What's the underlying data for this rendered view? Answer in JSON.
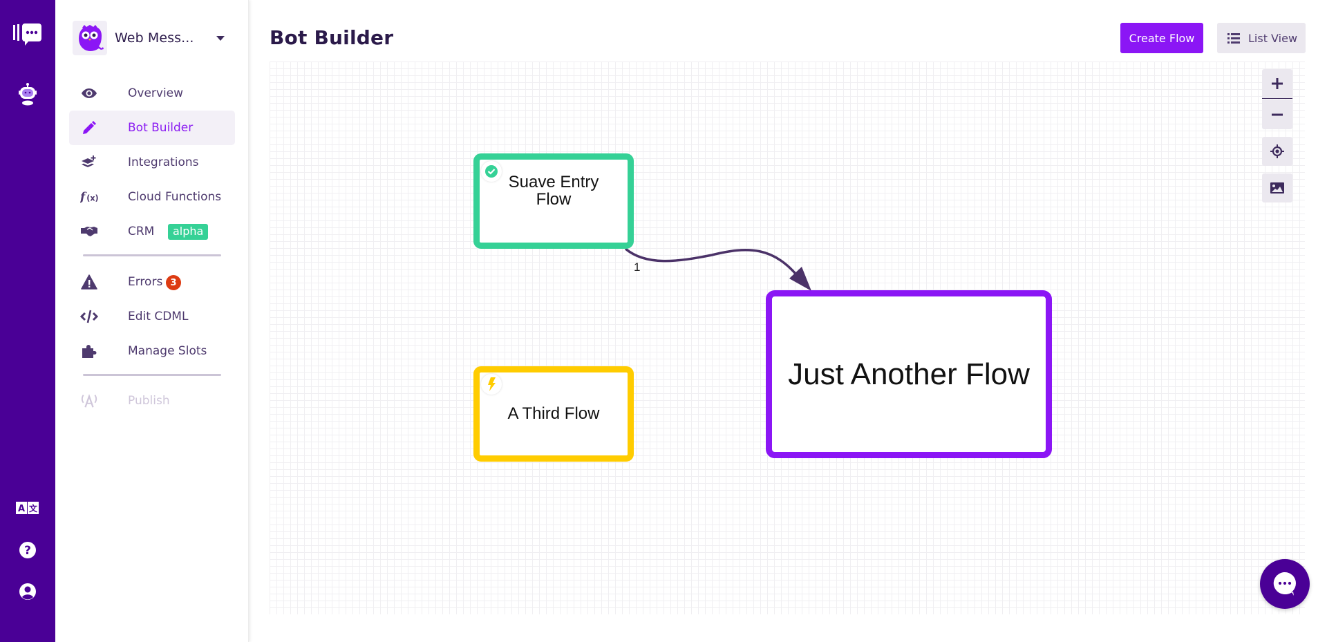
{
  "rail": {
    "icons": [
      "logo-chat-icon",
      "bot-icon",
      "translate-icon",
      "help-icon",
      "user-account-icon"
    ]
  },
  "workspace": {
    "name": "Web Mess...",
    "avatar_icon": "owl-mascot-icon"
  },
  "sidebar": {
    "items": [
      {
        "label": "Overview",
        "icon": "eye-icon"
      },
      {
        "label": "Bot Builder",
        "icon": "pencil-icon",
        "active": true
      },
      {
        "label": "Integrations",
        "icon": "layers-plus-icon"
      },
      {
        "label": "Cloud Functions",
        "icon": "function-icon"
      },
      {
        "label": "CRM",
        "icon": "handshake-icon",
        "badge": "alpha"
      },
      {
        "label": "Errors",
        "icon": "warning-icon",
        "count": "3"
      },
      {
        "label": "Edit CDML",
        "icon": "code-icon"
      },
      {
        "label": "Manage Slots",
        "icon": "puzzle-icon"
      },
      {
        "label": "Publish",
        "icon": "broadcast-icon",
        "disabled": true
      }
    ]
  },
  "header": {
    "title": "Bot Builder",
    "create_label": "Create Flow",
    "list_view_label": "List View"
  },
  "canvas": {
    "nodes": [
      {
        "label": "Suave Entry Flow",
        "status": "entry",
        "status_icon": "check-circle-icon",
        "color": "#35d196"
      },
      {
        "label": "Just Another Flow",
        "status": "default",
        "color": "#8b16f5"
      },
      {
        "label": "A Third Flow",
        "status": "trigger",
        "status_icon": "lightning-icon",
        "color": "#ffcc00"
      }
    ],
    "edges": [
      {
        "from": "Suave Entry Flow",
        "to": "Just Another Flow",
        "label": "1",
        "color": "#4b3268"
      }
    ],
    "controls": [
      "zoom-in",
      "zoom-out",
      "center",
      "export-image"
    ]
  },
  "colors": {
    "rail": "#4a0096",
    "accent": "#8b16f5",
    "text_dark": "#2b1a4a",
    "alpha_badge": "#35d196",
    "error_badge": "#dd3b12"
  }
}
